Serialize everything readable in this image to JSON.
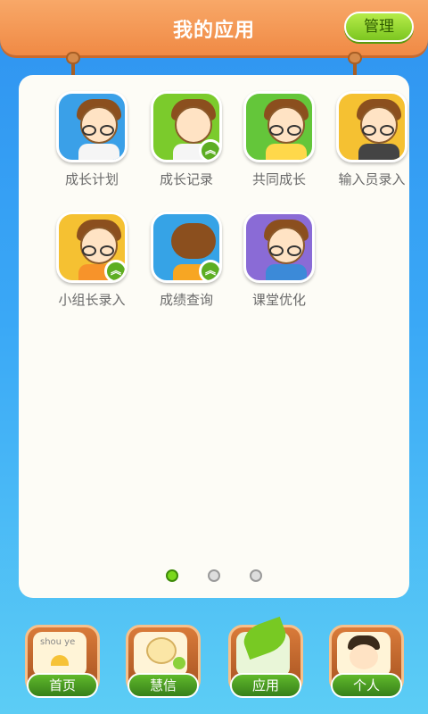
{
  "header": {
    "title": "我的应用",
    "manage_label": "管理"
  },
  "apps": [
    {
      "label": "成长计划",
      "theme": "#3aa0e8",
      "badge": false
    },
    {
      "label": "成长记录",
      "theme": "#7bcb2c",
      "badge": true
    },
    {
      "label": "共同成长",
      "theme": "#64c63a",
      "badge": false
    },
    {
      "label": "输入员录入",
      "theme": "#f5c132",
      "badge": false
    },
    {
      "label": "小组长录入",
      "theme": "#f5c132",
      "badge": true
    },
    {
      "label": "成绩查询",
      "theme": "#36a3e6",
      "badge": true
    },
    {
      "label": "课堂优化",
      "theme": "#8a6bd6",
      "badge": false
    }
  ],
  "pager": {
    "pages": 3,
    "current": 1
  },
  "nav": [
    {
      "label": "首页",
      "icon": "home-book-icon",
      "inner_text": "shou ye"
    },
    {
      "label": "慧信",
      "icon": "chat-bubble-icon"
    },
    {
      "label": "应用",
      "icon": "leaf-icon"
    },
    {
      "label": "个人",
      "icon": "person-icon"
    }
  ]
}
